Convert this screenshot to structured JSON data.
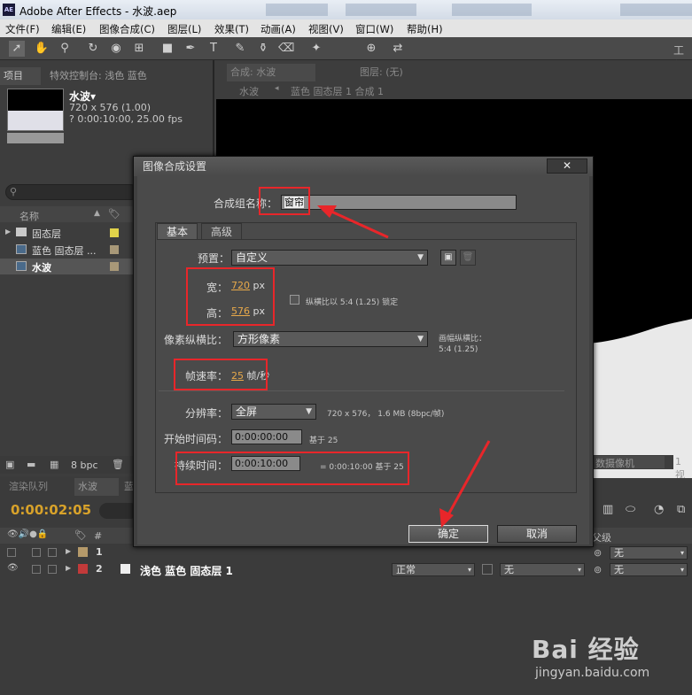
{
  "window": {
    "app_icon": "AE",
    "title": "Adobe After Effects - 水波.aep"
  },
  "menu": [
    "文件(F)",
    "编辑(E)",
    "图像合成(C)",
    "图层(L)",
    "效果(T)",
    "动画(A)",
    "视图(V)",
    "窗口(W)",
    "帮助(H)"
  ],
  "toolbar": {
    "workspace_label": "工作"
  },
  "project_panel": {
    "tab_project": "项目",
    "tab_effects": "特效控制台: 浅色 蓝色",
    "comp_name": "水波▾",
    "comp_size": "720 x 576 (1.00)",
    "comp_duration": "? 0:00:10:00, 25.00 fps",
    "col_name": "名称",
    "items": [
      "固态层",
      "蓝色 固态层 ...",
      "水波"
    ],
    "bpc": "8 bpc"
  },
  "comp_panel": {
    "tab": "合成: 水波",
    "tab_layer": "图层: (无)",
    "breadcrumb_comp": "水波",
    "breadcrumb_layer": "蓝色 固态层 1 合成 1",
    "btn_camera": "数摄像机",
    "btn_view": "1 视"
  },
  "timeline": {
    "tab_render": "渲染队列",
    "tab_comp": "水波",
    "tab_third": "蓝",
    "timecode": "0:00:02:05",
    "col_num": "#",
    "col_parent": "父级",
    "layers": [
      {
        "num": "1",
        "name": "",
        "mode": "",
        "trk": "",
        "parent": "无",
        "color": "#b59a6a"
      },
      {
        "num": "2",
        "name": "浅色 蓝色 固态层 1",
        "mode": "正常",
        "trk": "无",
        "parent": "无",
        "color": "#c23a3a"
      }
    ]
  },
  "dialog": {
    "title": "图像合成设置",
    "close_label": "✕",
    "name_label": "合成组名称：",
    "name_value": "窗帘",
    "tab_basic": "基本",
    "tab_advanced": "高级",
    "preset_label": "预置：",
    "preset_value": "自定义",
    "width_label": "宽：",
    "width_value": "720",
    "height_label": "高：",
    "height_value": "576",
    "unit_px": "px",
    "lock_label": "纵横比以 5:4 (1.25) 锁定",
    "par_label": "像素纵横比：",
    "par_value": "方形像素",
    "frame_aspect_label": "画幅纵横比：",
    "frame_aspect_value": "5:4 (1.25)",
    "fps_label": "帧速率：",
    "fps_value": "25",
    "fps_unit": "帧/秒",
    "res_label": "分辨率：",
    "res_value": "全屏",
    "res_info": "720 x 576， 1.6 MB (8bpc/帧)",
    "start_label": "开始时间码：",
    "start_value": "0:00:00:00",
    "start_base": "基于 25",
    "dur_label": "持续时间：",
    "dur_value": "0:00:10:00",
    "dur_info": "= 0:00:10:00  基于 25",
    "ok_label": "确定",
    "cancel_label": "取消"
  },
  "watermark": {
    "brand": "Bai 经验",
    "url": "jingyan.baidu.com"
  }
}
